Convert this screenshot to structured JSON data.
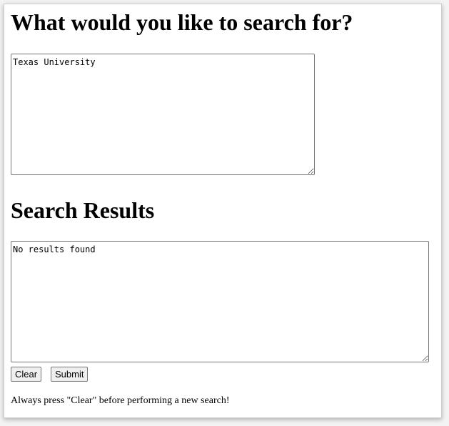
{
  "query_section": {
    "heading": "What would you like to search for?",
    "input_value": "Texas University"
  },
  "results_section": {
    "heading": "Search Results",
    "output_value": "No results found"
  },
  "buttons": {
    "clear_label": "Clear",
    "submit_label": "Submit"
  },
  "footer": {
    "note": "Always press \"Clear\" before performing a new search!"
  }
}
